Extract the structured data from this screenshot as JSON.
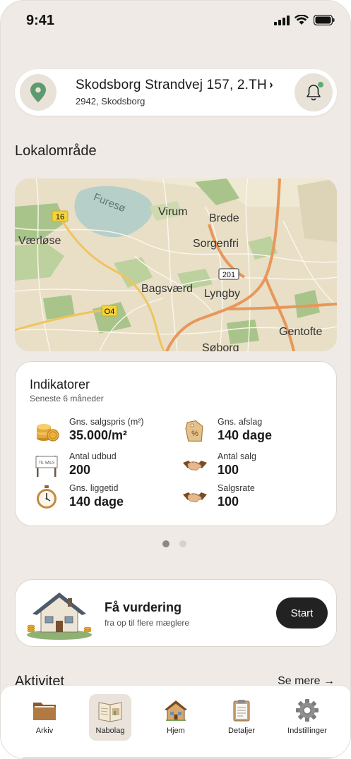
{
  "status_bar": {
    "time": "9:41"
  },
  "address": {
    "street": "Skodsborg Strandvej 157, 2.TH",
    "chevron": "›",
    "city": "2942, Skodsborg"
  },
  "local_area": {
    "title": "Lokalområde"
  },
  "map": {
    "place_labels": [
      "Furesø",
      "Værløse",
      "Virum",
      "Brede",
      "Sorgenfri",
      "Bagsværd",
      "Lyngby",
      "Gentofte",
      "Søborg"
    ],
    "road_badges": [
      "16",
      "201",
      "O4"
    ]
  },
  "indicators": {
    "title": "Indikatorer",
    "subtitle": "Seneste 6 måneder",
    "items": [
      {
        "label": "Gns. salgspris (m²)",
        "value": "35.000/m²",
        "icon": "coins-icon"
      },
      {
        "label": "Gns. afslag",
        "value": "140 dage",
        "icon": "price-tag-icon"
      },
      {
        "label": "Antal udbud",
        "value": "200",
        "icon": "for-sale-sign-icon",
        "sign_text": "TIL SALG"
      },
      {
        "label": "Antal salg",
        "value": "100",
        "icon": "handshake-icon"
      },
      {
        "label": "Gns. liggetid",
        "value": "140 dage",
        "icon": "stopwatch-icon"
      },
      {
        "label": "Salgsrate",
        "value": "100",
        "icon": "handshake-icon"
      }
    ],
    "pager": {
      "count": 2,
      "active": 0
    }
  },
  "valuation": {
    "title": "Få vurdering",
    "subtitle": "fra op til flere mæglere",
    "button": "Start"
  },
  "activity": {
    "title": "Aktivitet",
    "see_more": "Se mere →"
  },
  "tabbar": {
    "items": [
      {
        "label": "Arkiv",
        "icon": "folder-icon"
      },
      {
        "label": "Nabolag",
        "icon": "map-book-icon",
        "active": true
      },
      {
        "label": "Hjem",
        "icon": "house-icon"
      },
      {
        "label": "Detaljer",
        "icon": "clipboard-icon"
      },
      {
        "label": "Indstillinger",
        "icon": "gear-icon"
      }
    ]
  },
  "colors": {
    "background": "#efeae5",
    "card": "#ffffff",
    "button": "#222222",
    "notification_dot": "#5cae6e",
    "map_land": "#e8dfc6",
    "map_green": "#a9c48b",
    "map_water": "#b7cfc9",
    "map_road": "#e8975b"
  }
}
